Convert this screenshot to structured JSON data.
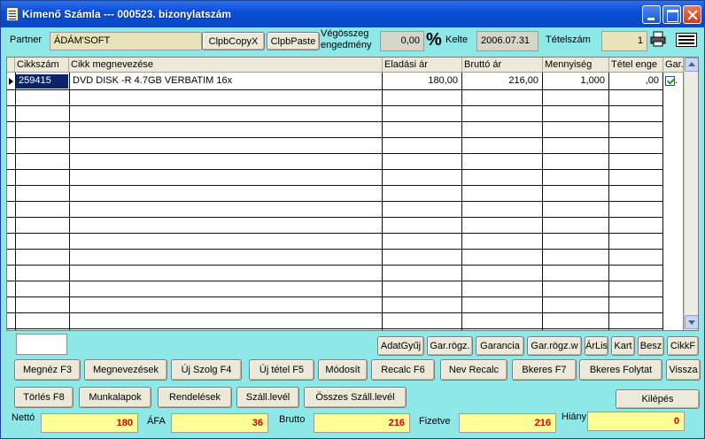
{
  "window": {
    "title": "Kimenő Számla --- 000523. bizonylatszám"
  },
  "header": {
    "partner_label": "Partner",
    "partner_value": "ÁDÁM'SOFT",
    "clipcopy_label": "ClpbCopyX",
    "clippaste_label": "ClpbPaste",
    "discount_label_line1": "Végösszeg",
    "discount_label_line2": "engedmény",
    "discount_value": "0,00",
    "percent_symbol": "%",
    "date_label": "Kelte",
    "date_value": "2006.07.31",
    "itemno_label": "Tételszám",
    "itemno_value": "1"
  },
  "grid": {
    "columns": [
      "Cikkszám",
      "Cikk megnevezése",
      "Eladási ár",
      "Bruttó ár",
      "Mennyiség",
      "Tétel enge",
      "Gar."
    ],
    "rows": [
      {
        "code": "259415",
        "name": "DVD DISK -R 4.7GB VERBATIM 16x",
        "sale_price": "180,00",
        "gross_price": "216,00",
        "qty": "1,000",
        "discount": ",00",
        "warranty": true,
        "warranty_suffix": "."
      }
    ]
  },
  "buttons_row1": {
    "adatgyuj": "AdatGyűj",
    "gar_rogz": "Gar.rögz.",
    "garancia": "Garancia",
    "gar_rogz_w": "Gar.rögz.w",
    "arlis": "ÁrLis",
    "kart": "Kart",
    "besz": "Besz",
    "cikkf": "CikkF"
  },
  "buttons_row2": {
    "megnez": "Megnéz F3",
    "megnevezesek": "Megnevezések",
    "uj_szolg": "Új Szolg F4",
    "uj_tetel": "Új tétel F5",
    "modosit": "Módosít",
    "recalc": "Recalc F6",
    "nev_recalc": "Nev Recalc",
    "bkeres": "Bkeres F7",
    "bkeres_folytat": "Bkeres Folytat",
    "vissza": "Vissza"
  },
  "buttons_row3": {
    "torles": "Törlés F8",
    "munkalapok": "Munkalapok",
    "rendelesek": "Rendelések",
    "szall_level": "Száll.levél",
    "osszes_szall": "Összes Száll.levél",
    "kilepes": "Kilépés"
  },
  "totals": {
    "netto_label": "Nettó",
    "netto_value": "180",
    "afa_label": "ÁFA",
    "afa_value": "36",
    "brutto_label": "Brutto",
    "brutto_value": "216",
    "fizetve_label": "Fizetve",
    "fizetve_value": "216",
    "hiany_label": "Hiány",
    "hiany_value": "0"
  },
  "colors": {
    "window_bg": "#8ee8e8",
    "field_bg": "#e9e3b9",
    "totals_bg": "#ffff96",
    "totals_text": "#d40000",
    "titlebar": "#0a4fd8"
  },
  "icons": [
    "app-icon",
    "printer-icon",
    "keyboard-icon",
    "row-pointer-icon",
    "checkbox-checked-icon"
  ]
}
